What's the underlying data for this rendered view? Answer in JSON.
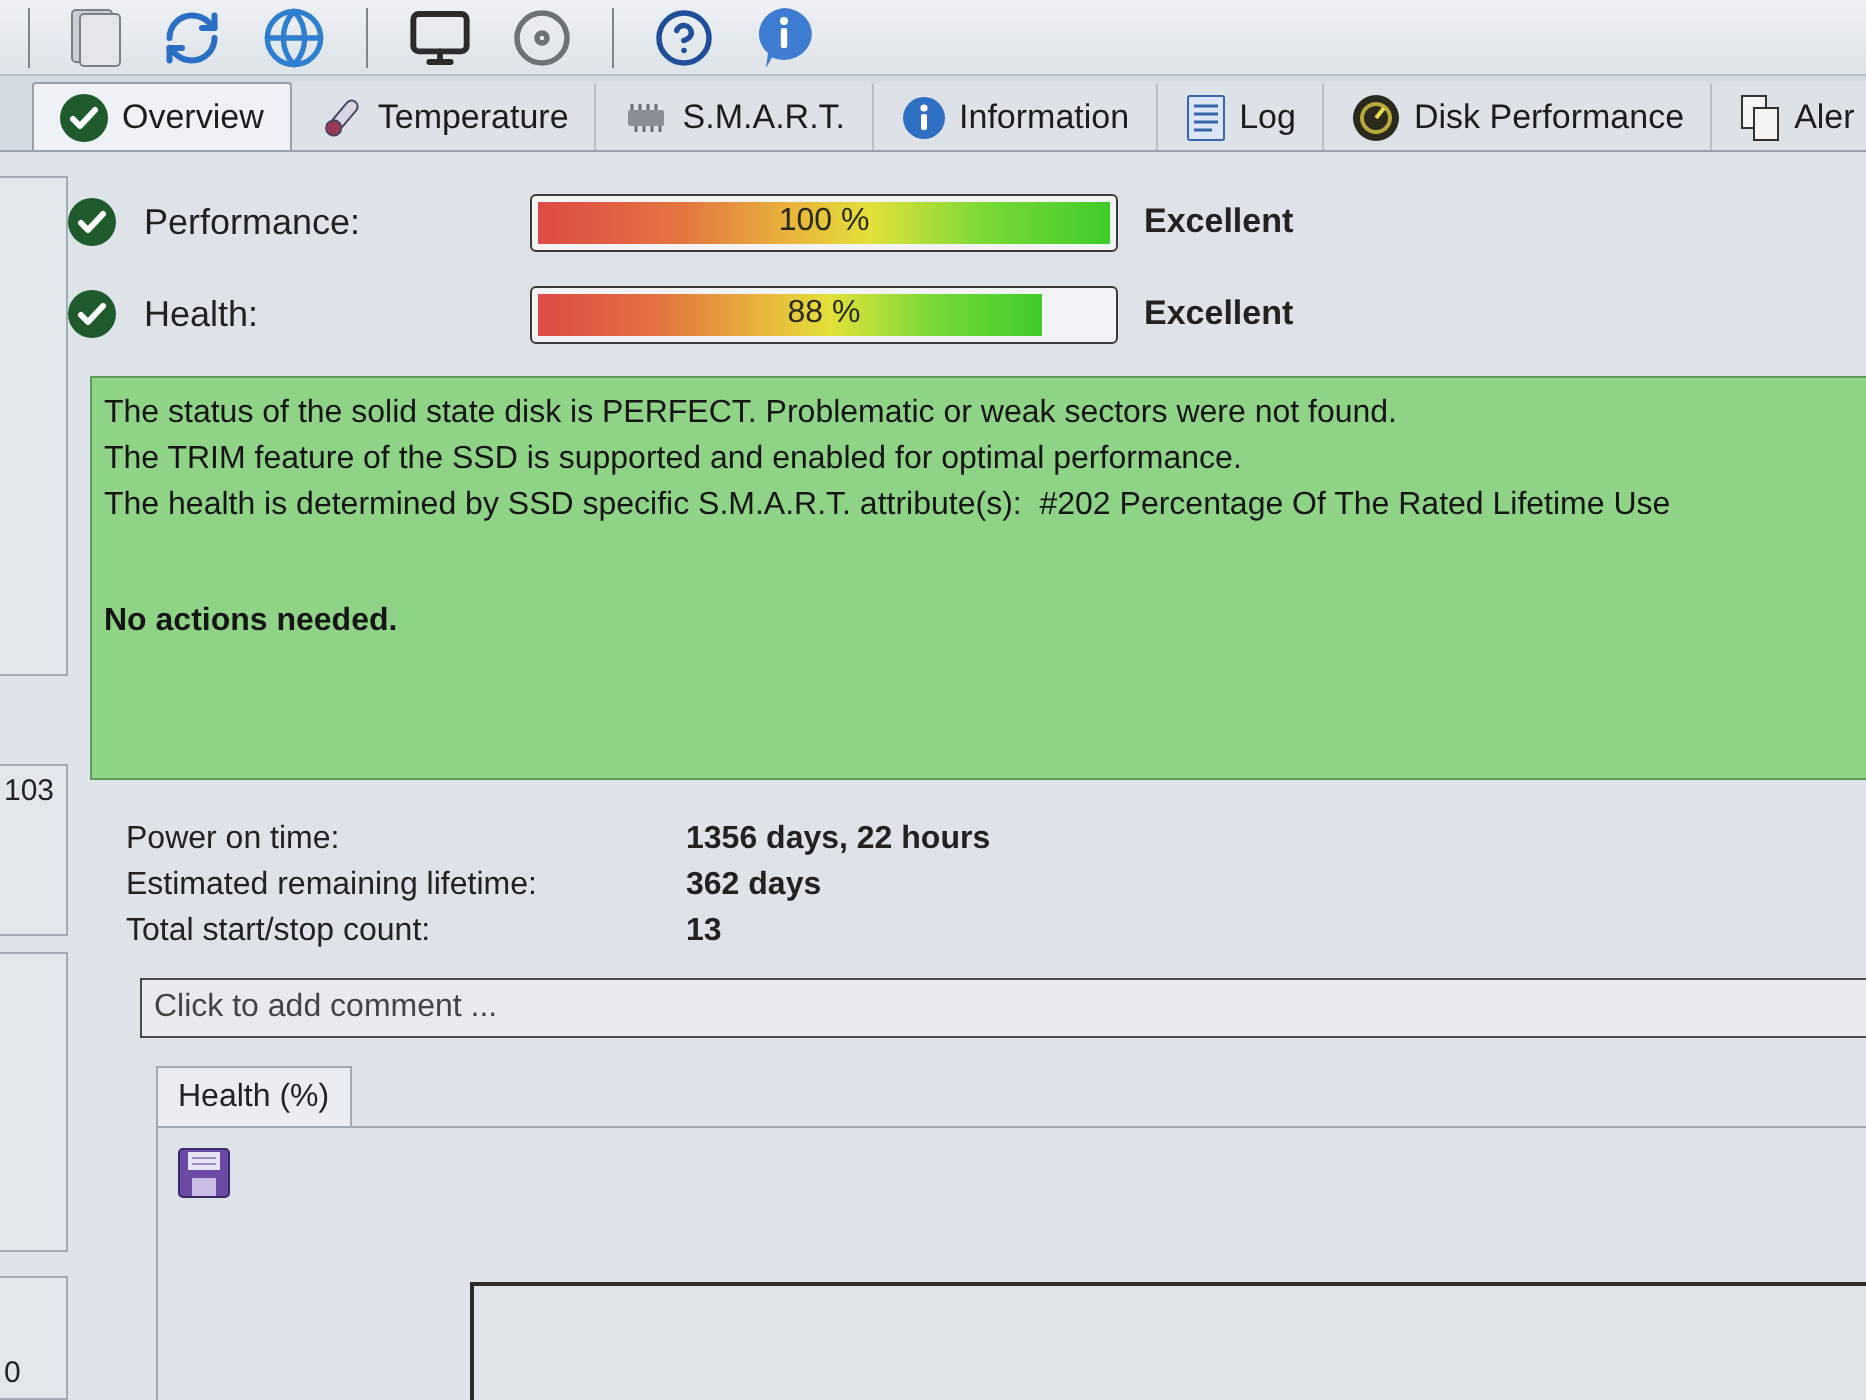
{
  "tabs": [
    {
      "label": "Overview",
      "selected": true
    },
    {
      "label": "Temperature",
      "selected": false
    },
    {
      "label": "S.M.A.R.T.",
      "selected": false
    },
    {
      "label": "Information",
      "selected": false
    },
    {
      "label": "Log",
      "selected": false
    },
    {
      "label": "Disk Performance",
      "selected": false
    },
    {
      "label": "Aler",
      "selected": false
    }
  ],
  "sidebar": {
    "items": [
      "103",
      "0"
    ]
  },
  "status_rows": [
    {
      "label": "Performance:",
      "level": 1,
      "reading": "100 %",
      "rating": "Excellent"
    },
    {
      "label": "Health:",
      "level": 0.88,
      "reading": "88 %",
      "rating": "Excellent"
    }
  ],
  "status_message": {
    "lines": [
      "The status of the solid state disk is PERFECT. Problematic or weak sectors were not found.",
      "The TRIM feature of the SSD is supported and enabled for optimal performance.",
      "The health is determined by SSD specific S.M.A.R.T. attribute(s):  #202 Percentage Of The Rated Lifetime Use"
    ],
    "conclusion": "No actions needed."
  },
  "details": [
    {
      "label": "Power on time:",
      "value": "1356 days, 22 hours"
    },
    {
      "label": "Estimated remaining lifetime:",
      "value": "362 days"
    },
    {
      "label": "Total start/stop count:",
      "value": "13"
    }
  ],
  "comment": {
    "placeholder": "Click to add comment ..."
  },
  "history_panel": {
    "tabs": [
      {
        "label": "Health (%)",
        "selected": true
      }
    ]
  }
}
